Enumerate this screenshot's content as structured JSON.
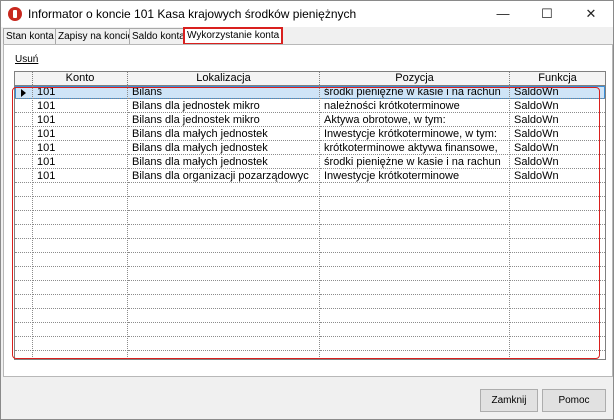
{
  "window": {
    "title": "Informator o koncie 101  Kasa krajowych środków pieniężnych",
    "minimize_icon": "minimize-icon",
    "maximize_icon": "maximize-icon",
    "close_icon": "close-icon",
    "minimize_glyph": "—",
    "maximize_glyph": "☐",
    "close_glyph": "✕"
  },
  "tabs": [
    {
      "label": "Stan konta"
    },
    {
      "label": "Zapisy na koncie"
    },
    {
      "label": "Saldo konta"
    },
    {
      "label": "Wykorzystanie konta",
      "active": true
    }
  ],
  "actions": {
    "delete_link": "Usuń"
  },
  "grid": {
    "columns": [
      "Konto",
      "Lokalizacja",
      "Pozycja",
      "Funkcja"
    ],
    "rows": [
      [
        "101",
        "Bilans",
        "środki pieniężne w kasie i na rachun",
        "SaldoWn"
      ],
      [
        "101",
        "Bilans dla jednostek mikro",
        "należności krótkoterminowe",
        "SaldoWn"
      ],
      [
        "101",
        "Bilans dla jednostek mikro",
        "Aktywa obrotowe, w tym:",
        "SaldoWn"
      ],
      [
        "101",
        "Bilans dla małych jednostek",
        "Inwestycje krótkoterminowe, w tym:",
        "SaldoWn"
      ],
      [
        "101",
        "Bilans dla małych jednostek",
        "krótkoterminowe aktywa finansowe,",
        "SaldoWn"
      ],
      [
        "101",
        "Bilans dla małych jednostek",
        "środki pieniężne w kasie i na rachun",
        "SaldoWn"
      ],
      [
        "101",
        "Bilans dla organizacji pozarządowyc",
        "Inwestycje krótkoterminowe",
        "SaldoWn"
      ]
    ],
    "empty_rows": 13,
    "selected_row": 0
  },
  "buttons": {
    "close": "Zamknij",
    "help": "Pomoc"
  },
  "colors": {
    "highlight_border": "#d9201e",
    "selection": "#cfe4f7"
  }
}
